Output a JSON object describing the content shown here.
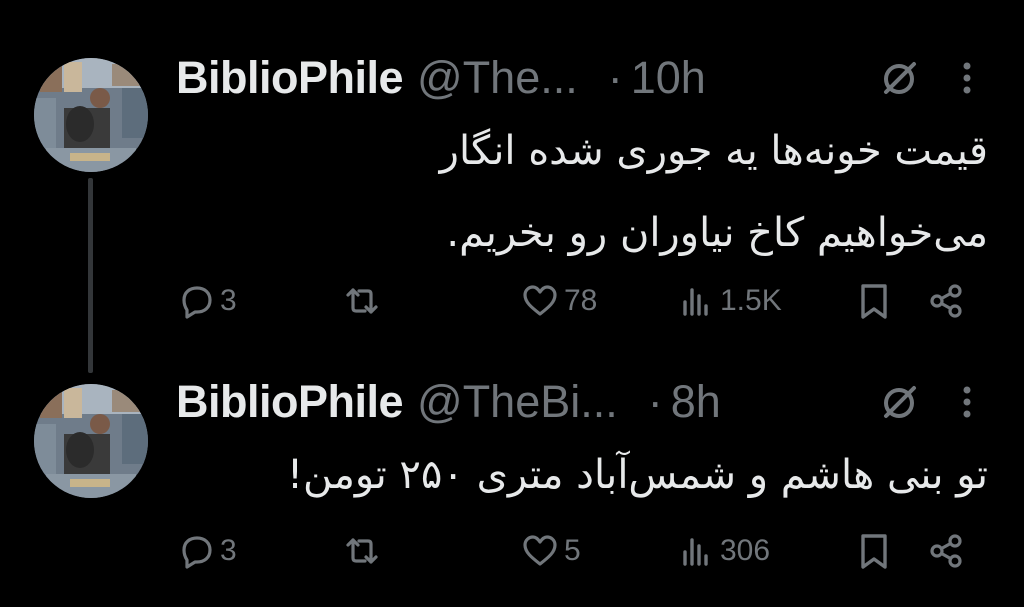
{
  "tweets": [
    {
      "display_name": "BiblioPhile",
      "handle": "@The...",
      "separator": "·",
      "time": "10h",
      "text_lines": [
        "قیمت خونه‌ها یه جوری شده انگار",
        "می‌خواهیم کاخ نیاوران رو بخریم."
      ],
      "replies": "3",
      "reposts": "",
      "likes": "78",
      "views": "1.5K"
    },
    {
      "display_name": "BiblioPhile",
      "handle": "@TheBi...",
      "separator": "·",
      "time": "8h",
      "text_lines": [
        "تو بنی هاشم و شمس‌آباد متری ۲۵۰ تومن!"
      ],
      "replies": "3",
      "reposts": "",
      "likes": "5",
      "views": "306"
    }
  ],
  "icons": {
    "reply": "reply-icon",
    "repost": "repost-icon",
    "like": "heart-icon",
    "views": "views-icon",
    "bookmark": "bookmark-icon",
    "share": "share-icon",
    "grok": "grok-icon",
    "more": "more-icon"
  },
  "colors": {
    "background": "#000000",
    "primary_text": "#e7e9ea",
    "secondary_text": "#71767b",
    "thread_line": "#333639"
  }
}
